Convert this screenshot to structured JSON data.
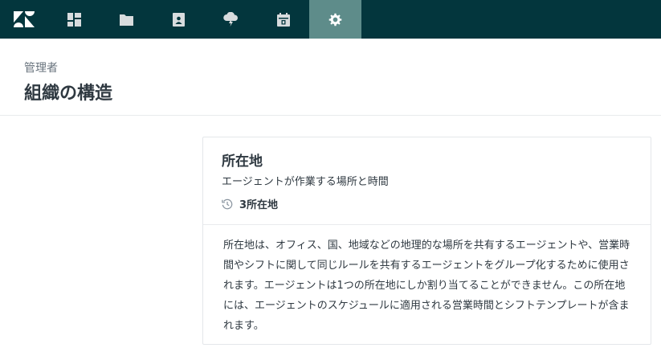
{
  "nav": {
    "items": [
      {
        "icon": "zendesk-logo-icon"
      },
      {
        "icon": "dashboard-icon"
      },
      {
        "icon": "folder-icon"
      },
      {
        "icon": "contact-book-icon"
      },
      {
        "icon": "cloud-lightning-icon"
      },
      {
        "icon": "calendar-icon"
      },
      {
        "icon": "gear-icon",
        "active": true
      }
    ],
    "colors": {
      "bar": "#03363d",
      "active": "#5e8c8a",
      "icon": "#d8dcde"
    }
  },
  "header": {
    "breadcrumb": "管理者",
    "title": "組織の構造"
  },
  "card": {
    "title": "所在地",
    "subtitle": "エージェントが作業する場所と時間",
    "stat_icon": "clock-history-icon",
    "stat": "3所在地",
    "description": "所在地は、オフィス、国、地域などの地理的な場所を共有するエージェントや、営業時間やシフトに関して同じルールを共有するエージェントをグループ化するために使用されます。エージェントは1つの所在地にしか割り当てることができません。この所在地には、エージェントのスケジュールに適用される営業時間とシフトテンプレートが含まれます。"
  }
}
